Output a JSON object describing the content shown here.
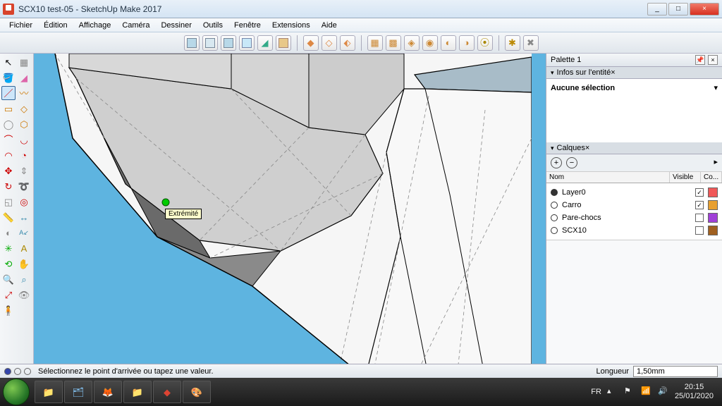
{
  "window": {
    "title": "SCX10 test-05 - SketchUp Make 2017",
    "minimize": "_",
    "maximize": "□",
    "close": "×"
  },
  "menu": [
    "Fichier",
    "Édition",
    "Affichage",
    "Caméra",
    "Dessiner",
    "Outils",
    "Fenêtre",
    "Extensions",
    "Aide"
  ],
  "tooltip": "Extrémité",
  "palette": {
    "title": "Palette 1",
    "entity_header": "Infos sur l'entité",
    "entity_body": "Aucune sélection",
    "layers_header": "Calques",
    "cols": {
      "name": "Nom",
      "visible": "Visible",
      "color": "Co..."
    },
    "layers": [
      {
        "name": "Layer0",
        "selected": true,
        "visible": true,
        "color": "#f05858"
      },
      {
        "name": "Carro",
        "selected": false,
        "visible": true,
        "color": "#e8a030"
      },
      {
        "name": "Pare-chocs",
        "selected": false,
        "visible": false,
        "color": "#a040d8"
      },
      {
        "name": "SCX10",
        "selected": false,
        "visible": false,
        "color": "#a06020"
      }
    ]
  },
  "status": {
    "hint": "Sélectionnez le point d'arrivée ou tapez une valeur.",
    "measure_label": "Longueur",
    "measure_value": "1,50mm"
  },
  "taskbar": {
    "lang": "FR",
    "time": "20:15",
    "date": "25/01/2020"
  }
}
